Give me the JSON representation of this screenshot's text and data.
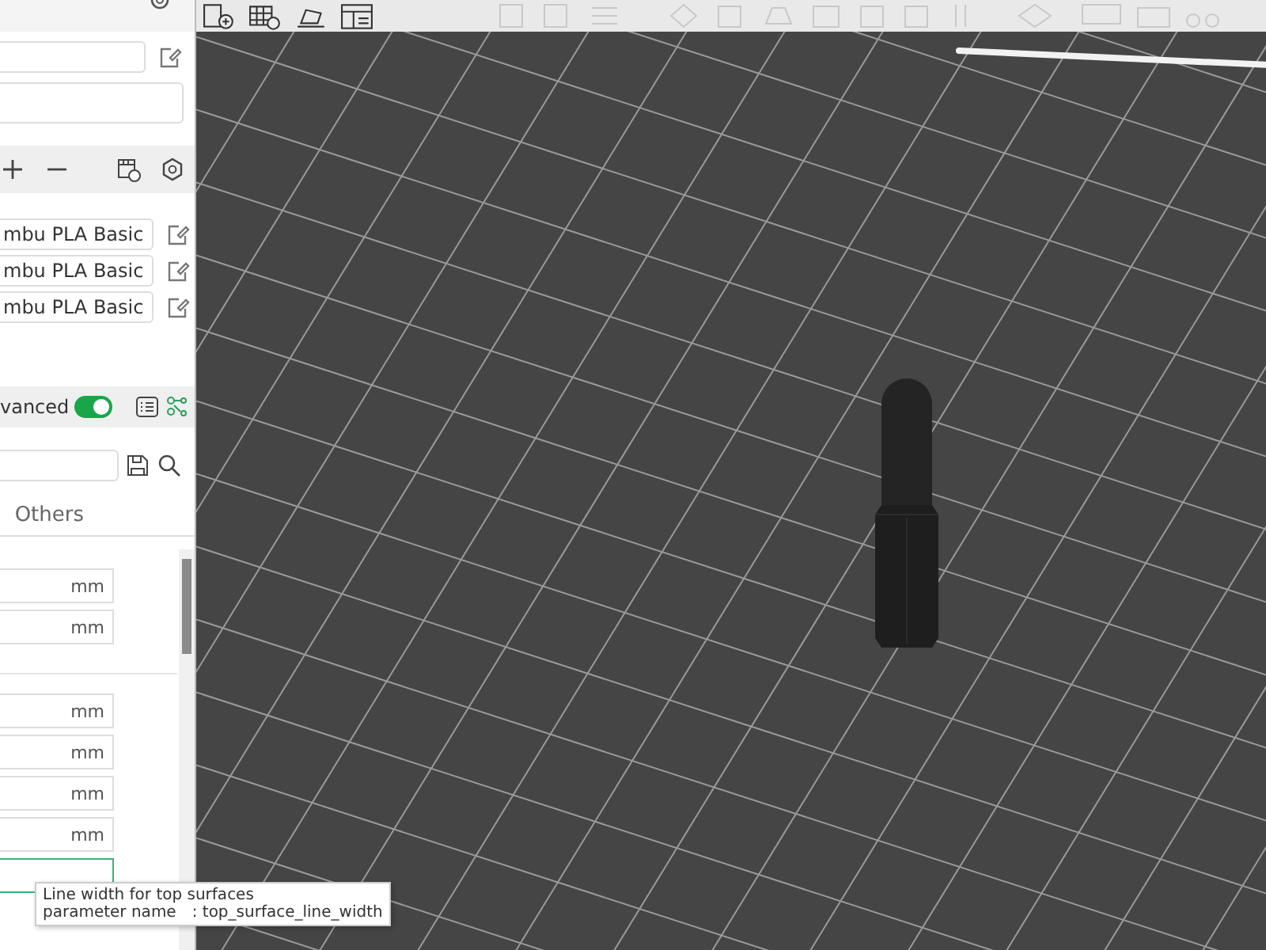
{
  "filaments": [
    {
      "name": "mbu PLA Basic"
    },
    {
      "name": "mbu PLA Basic"
    },
    {
      "name": "mbu PLA Basic"
    }
  ],
  "mode_toggle": {
    "label": "vanced",
    "on": true
  },
  "tabs": [
    {
      "label": "Others",
      "selected": false
    }
  ],
  "setting_groups": [
    {
      "fields": [
        {
          "unit": "mm",
          "focused": false
        },
        {
          "unit": "mm",
          "focused": false
        }
      ]
    },
    {
      "fields": [
        {
          "unit": "mm",
          "focused": false
        },
        {
          "unit": "mm",
          "focused": false
        },
        {
          "unit": "mm",
          "focused": false
        },
        {
          "unit": "mm",
          "focused": false
        },
        {
          "focused": true
        }
      ]
    }
  ],
  "tooltip": {
    "text": "Line width for top surfaces",
    "key_label": "parameter name",
    "key_value": ": top_surface_line_width"
  }
}
